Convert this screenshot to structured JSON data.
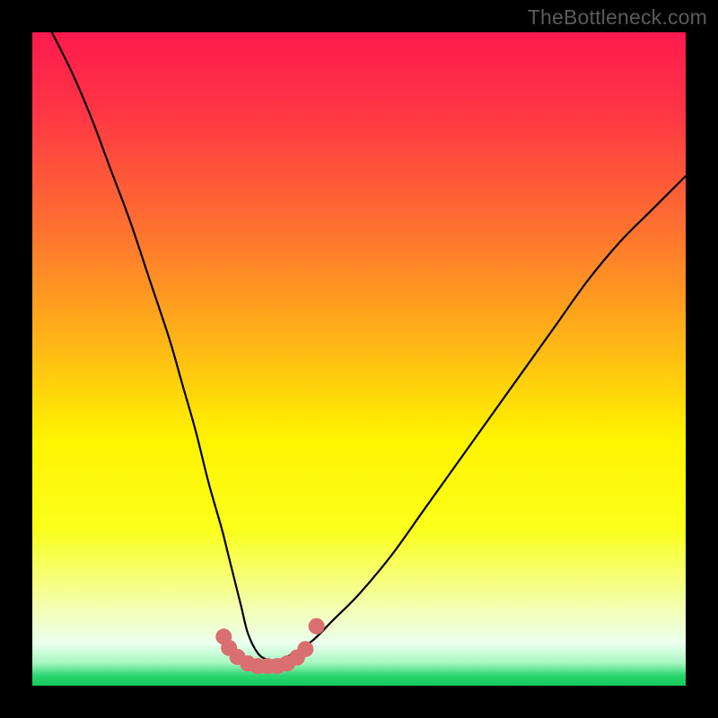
{
  "watermark": "TheBottleneck.com",
  "gradient": {
    "stops": [
      {
        "offset": 0.0,
        "color": "#ff1a4e"
      },
      {
        "offset": 0.12,
        "color": "#ff3545"
      },
      {
        "offset": 0.3,
        "color": "#ff7130"
      },
      {
        "offset": 0.48,
        "color": "#ffb815"
      },
      {
        "offset": 0.62,
        "color": "#fff300"
      },
      {
        "offset": 0.76,
        "color": "#fbff1a"
      },
      {
        "offset": 0.88,
        "color": "#f3ffb0"
      },
      {
        "offset": 0.935,
        "color": "#ecffef"
      },
      {
        "offset": 0.965,
        "color": "#a7f7c1"
      },
      {
        "offset": 0.985,
        "color": "#28d66e"
      },
      {
        "offset": 1.0,
        "color": "#13c95c"
      }
    ]
  },
  "chart_data": {
    "type": "line",
    "title": "",
    "xlabel": "",
    "ylabel": "",
    "xlim": [
      0,
      100
    ],
    "ylim": [
      0,
      100
    ],
    "series": [
      {
        "name": "curve",
        "stroke": "#000000",
        "x": [
          3,
          6,
          9,
          12,
          15,
          18,
          21,
          23,
          25,
          27,
          29,
          30,
          31,
          32,
          33,
          34.5,
          36,
          38,
          40,
          43,
          46,
          50,
          55,
          60,
          65,
          70,
          75,
          80,
          85,
          90,
          95,
          100
        ],
        "y": [
          100,
          94,
          87,
          79,
          71,
          62,
          53,
          46,
          39,
          31,
          24,
          20,
          16,
          12,
          8,
          5,
          4,
          4,
          5,
          7,
          10,
          14,
          20,
          27,
          34,
          41,
          48,
          55,
          62,
          68,
          73,
          78
        ]
      }
    ],
    "markers": {
      "color": "#d96f70",
      "radius_px": 9,
      "points_xy": [
        [
          29.3,
          7.5
        ],
        [
          30.1,
          5.8
        ],
        [
          31.4,
          4.4
        ],
        [
          33.0,
          3.4
        ],
        [
          34.5,
          3.0
        ],
        [
          36.0,
          3.0
        ],
        [
          37.5,
          3.0
        ],
        [
          39.0,
          3.4
        ],
        [
          40.5,
          4.3
        ],
        [
          41.8,
          5.6
        ],
        [
          43.5,
          9.1
        ]
      ]
    }
  }
}
